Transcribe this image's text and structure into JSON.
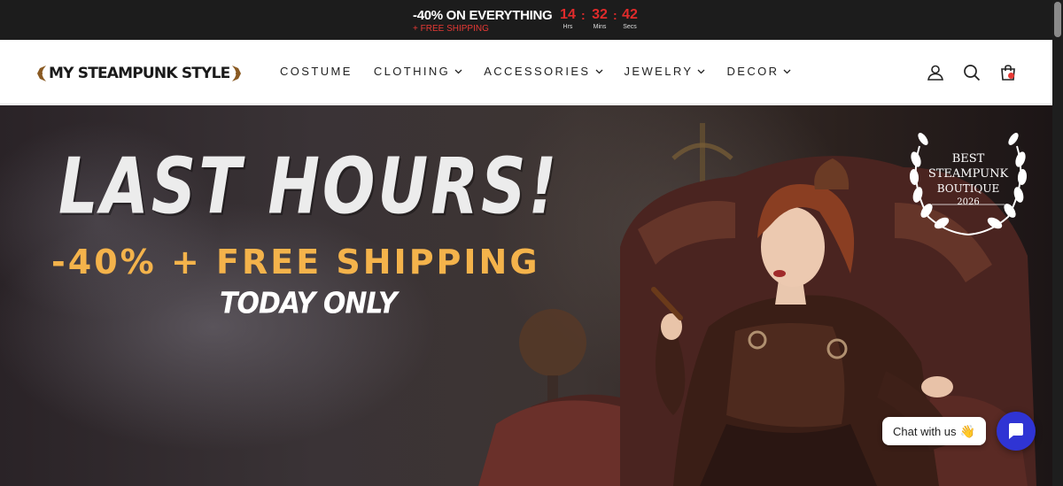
{
  "announcement": {
    "headline": "-40% ON EVERYTHING",
    "subline": "+ FREE SHIPPING",
    "countdown": [
      {
        "value": "14",
        "label": "Hrs"
      },
      {
        "value": "32",
        "label": "Mins"
      },
      {
        "value": "42",
        "label": "Secs"
      }
    ],
    "separator": ":"
  },
  "header": {
    "logo_text": "MY STEAMPUNK STYLE",
    "nav": [
      {
        "label": "COSTUME",
        "has_dropdown": false
      },
      {
        "label": "CLOTHING",
        "has_dropdown": true
      },
      {
        "label": "ACCESSORIES",
        "has_dropdown": true
      },
      {
        "label": "JEWELRY",
        "has_dropdown": true
      },
      {
        "label": "DECOR",
        "has_dropdown": true
      }
    ],
    "icons": [
      "account-icon",
      "search-icon",
      "cart-icon"
    ]
  },
  "hero": {
    "title": "LAST HOURS!",
    "subtitle": "-40% + FREE SHIPPING",
    "tagline": "TODAY ONLY",
    "badge": {
      "line1": "BEST",
      "line2": "STEAMPUNK",
      "line3": "BOUTIQUE",
      "year": "2026"
    }
  },
  "chat": {
    "label": "Chat with us",
    "emoji": "👋"
  },
  "colors": {
    "accent_red": "#e02b2b",
    "hero_orange": "#f4b34b",
    "chat_blue": "#2f34d4",
    "topbar": "#1c1c1c"
  }
}
